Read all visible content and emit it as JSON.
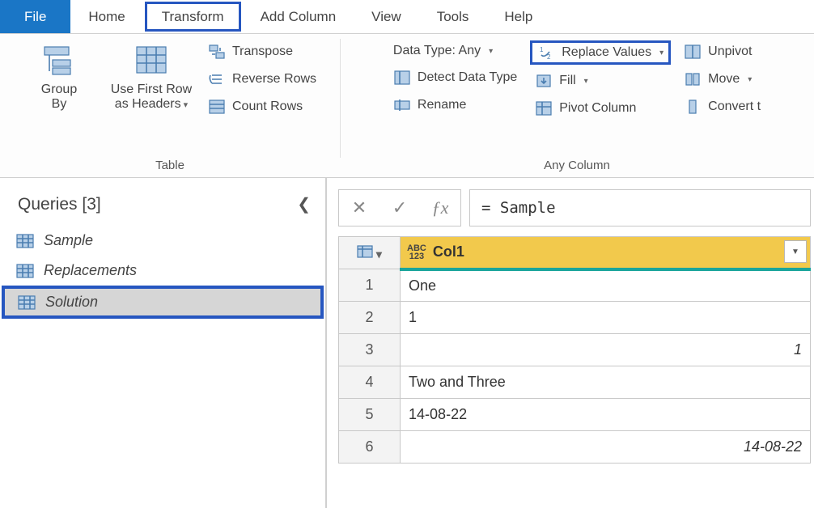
{
  "menu": {
    "file": "File",
    "home": "Home",
    "transform": "Transform",
    "add_column": "Add Column",
    "view": "View",
    "tools": "Tools",
    "help": "Help"
  },
  "ribbon": {
    "table": {
      "label": "Table",
      "group_by": "Group\nBy",
      "use_first_row": "Use First Row\nas Headers",
      "transpose": "Transpose",
      "reverse_rows": "Reverse Rows",
      "count_rows": "Count Rows"
    },
    "any_column": {
      "label": "Any Column",
      "data_type": "Data Type: Any",
      "detect": "Detect Data Type",
      "rename": "Rename",
      "replace_values": "Replace Values",
      "fill": "Fill",
      "pivot": "Pivot Column",
      "unpivot": "Unpivot",
      "move": "Move",
      "convert": "Convert t"
    }
  },
  "queries": {
    "title": "Queries [3]",
    "items": [
      {
        "label": "Sample"
      },
      {
        "label": "Replacements"
      },
      {
        "label": "Solution"
      }
    ]
  },
  "formula": "= Sample",
  "grid": {
    "col_name": "Col1",
    "type_label_top": "ABC",
    "type_label_bottom": "123",
    "rows": [
      {
        "n": "1",
        "v": "One",
        "align": "left"
      },
      {
        "n": "2",
        "v": "1",
        "align": "left"
      },
      {
        "n": "3",
        "v": "1",
        "align": "right"
      },
      {
        "n": "4",
        "v": "Two and Three",
        "align": "left"
      },
      {
        "n": "5",
        "v": "14-08-22",
        "align": "left"
      },
      {
        "n": "6",
        "v": "14-08-22",
        "align": "right"
      }
    ]
  }
}
